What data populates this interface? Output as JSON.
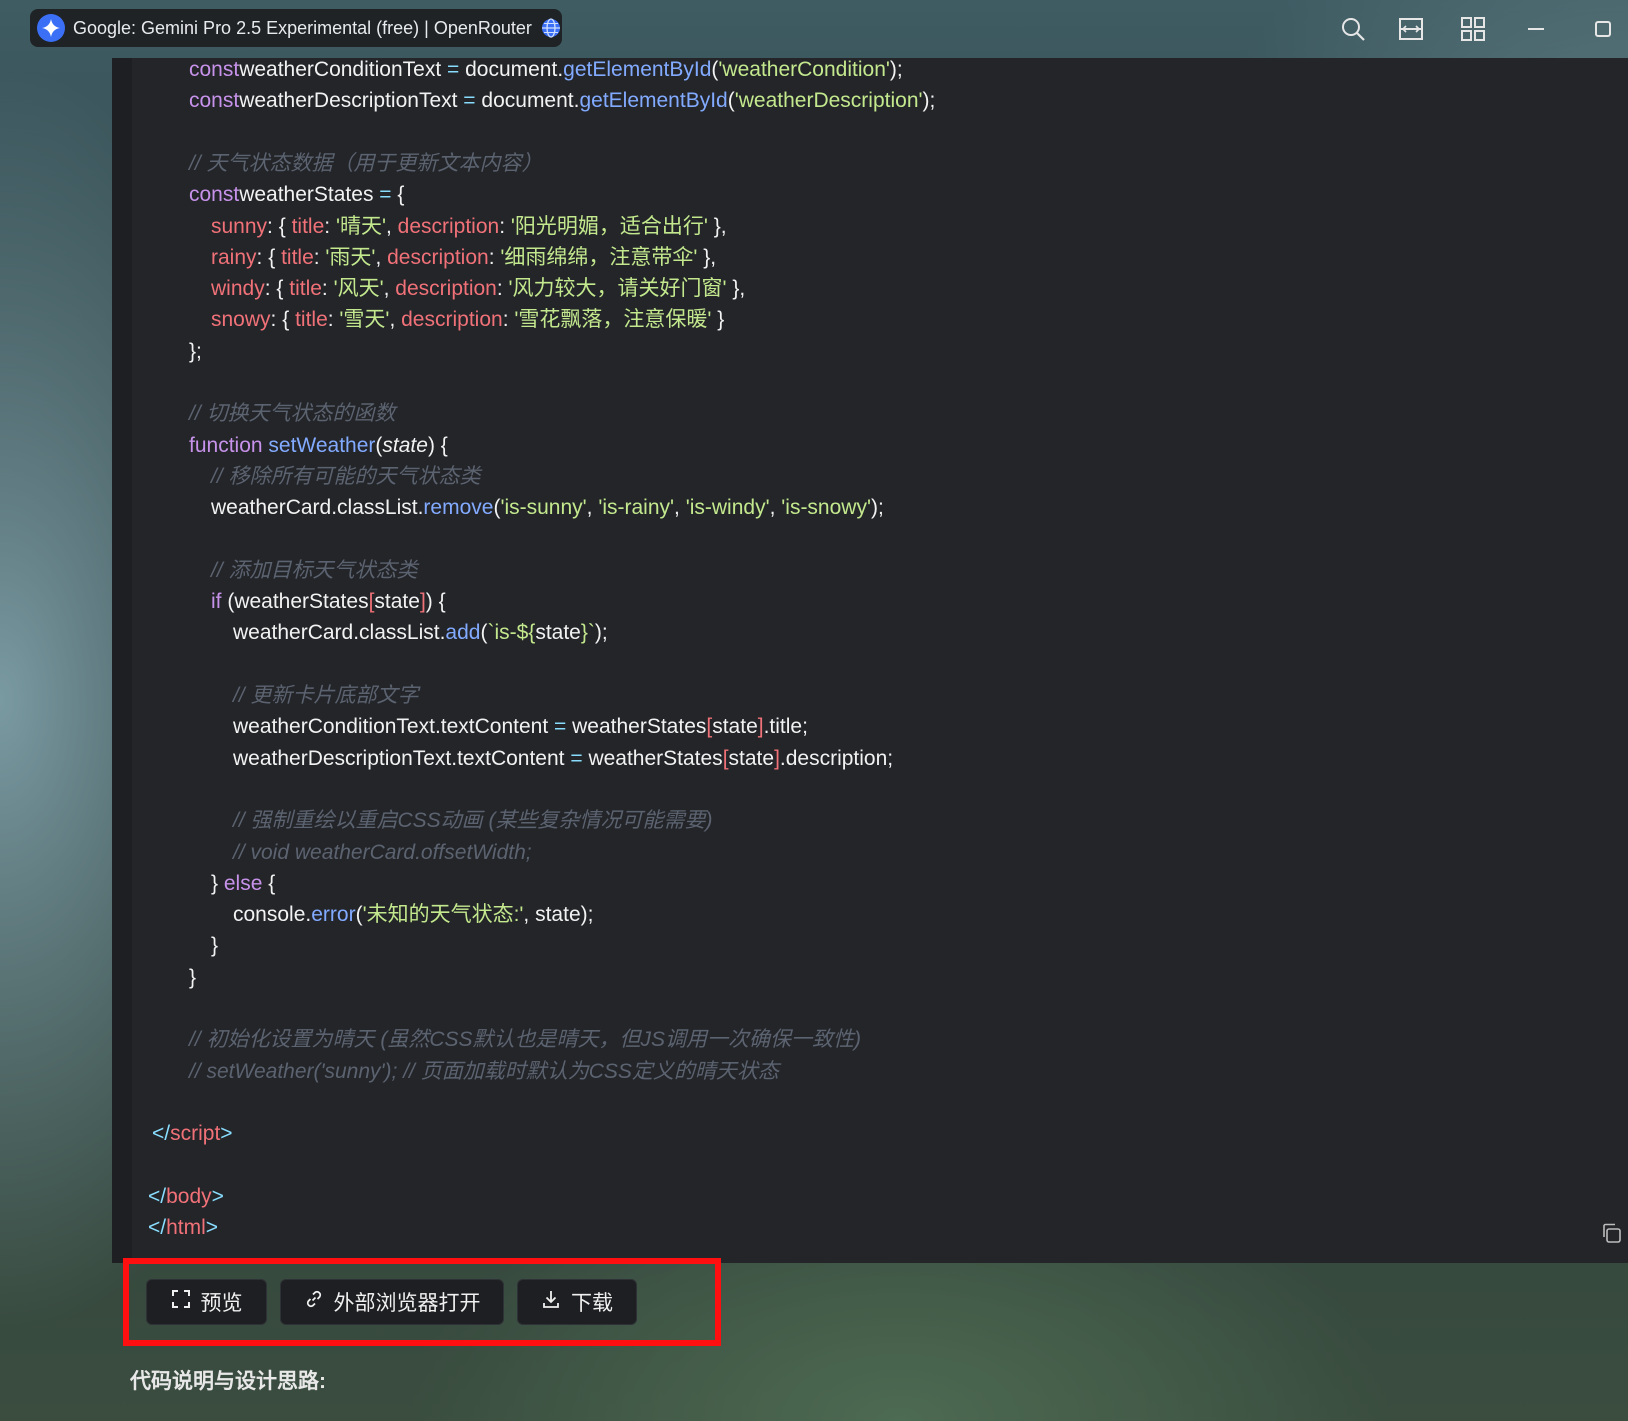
{
  "window": {
    "tab_title": "Google: Gemini Pro 2.5 Experimental (free) | OpenRouter",
    "icons": [
      "gemini-logo-icon",
      "globe-icon",
      "search-icon",
      "translate-icon",
      "grid-icon",
      "minimize-icon",
      "maximize-icon"
    ]
  },
  "code_lines": [
    {
      "indent": 2,
      "parts": [
        [
          "kw",
          "const"
        ],
        [
          "",
          "weatherConditionText"
        ],
        [
          "op",
          " = "
        ],
        [
          "",
          "document."
        ],
        [
          "fn",
          "getElementById"
        ],
        [
          "",
          "("
        ],
        [
          "str",
          "'weatherCondition'"
        ],
        [
          "",
          ");"
        ]
      ]
    },
    {
      "indent": 2,
      "parts": [
        [
          "kw",
          "const"
        ],
        [
          "",
          "weatherDescriptionText"
        ],
        [
          "op",
          " = "
        ],
        [
          "",
          "document."
        ],
        [
          "fn",
          "getElementById"
        ],
        [
          "",
          "("
        ],
        [
          "str",
          "'weatherDescription'"
        ],
        [
          "",
          ");"
        ]
      ]
    },
    {
      "indent": 0,
      "parts": []
    },
    {
      "indent": 2,
      "parts": [
        [
          "com",
          "// 天气状态数据（用于更新文本内容）"
        ]
      ]
    },
    {
      "indent": 2,
      "parts": [
        [
          "kw",
          "const"
        ],
        [
          "",
          "weatherStates"
        ],
        [
          "op",
          " = "
        ],
        [
          "",
          "{"
        ]
      ]
    },
    {
      "indent": 3,
      "parts": [
        [
          "prop",
          "sunny"
        ],
        [
          "",
          ": { "
        ],
        [
          "prop",
          "title"
        ],
        [
          "",
          ": "
        ],
        [
          "str",
          "'晴天'"
        ],
        [
          "",
          ", "
        ],
        [
          "prop",
          "description"
        ],
        [
          "",
          ": "
        ],
        [
          "str",
          "'阳光明媚，适合出行'"
        ],
        [
          "",
          " },"
        ]
      ]
    },
    {
      "indent": 3,
      "parts": [
        [
          "prop",
          "rainy"
        ],
        [
          "",
          ": { "
        ],
        [
          "prop",
          "title"
        ],
        [
          "",
          ": "
        ],
        [
          "str",
          "'雨天'"
        ],
        [
          "",
          ", "
        ],
        [
          "prop",
          "description"
        ],
        [
          "",
          ": "
        ],
        [
          "str",
          "'细雨绵绵，注意带伞'"
        ],
        [
          "",
          " },"
        ]
      ]
    },
    {
      "indent": 3,
      "parts": [
        [
          "prop",
          "windy"
        ],
        [
          "",
          ": { "
        ],
        [
          "prop",
          "title"
        ],
        [
          "",
          ": "
        ],
        [
          "str",
          "'风天'"
        ],
        [
          "",
          ", "
        ],
        [
          "prop",
          "description"
        ],
        [
          "",
          ": "
        ],
        [
          "str",
          "'风力较大，请关好门窗'"
        ],
        [
          "",
          " },"
        ]
      ]
    },
    {
      "indent": 3,
      "parts": [
        [
          "prop",
          "snowy"
        ],
        [
          "",
          ": { "
        ],
        [
          "prop",
          "title"
        ],
        [
          "",
          ": "
        ],
        [
          "str",
          "'雪天'"
        ],
        [
          "",
          ", "
        ],
        [
          "prop",
          "description"
        ],
        [
          "",
          ": "
        ],
        [
          "str",
          "'雪花飘落，注意保暖'"
        ],
        [
          "",
          " }"
        ]
      ]
    },
    {
      "indent": 2,
      "parts": [
        [
          "",
          "};"
        ]
      ]
    },
    {
      "indent": 0,
      "parts": []
    },
    {
      "indent": 2,
      "parts": [
        [
          "com",
          "// 切换天气状态的函数"
        ]
      ]
    },
    {
      "indent": 2,
      "parts": [
        [
          "kw",
          "function"
        ],
        [
          "fn",
          " setWeather"
        ],
        [
          "",
          "("
        ],
        [
          "it",
          "state"
        ],
        [
          "",
          ") {"
        ]
      ]
    },
    {
      "indent": 3,
      "parts": [
        [
          "com",
          "// 移除所有可能的天气状态类"
        ]
      ]
    },
    {
      "indent": 3,
      "parts": [
        [
          "",
          "weatherCard.classList."
        ],
        [
          "fn",
          "remove"
        ],
        [
          "",
          "("
        ],
        [
          "str",
          "'is-sunny'"
        ],
        [
          "",
          ", "
        ],
        [
          "str",
          "'is-rainy'"
        ],
        [
          "",
          ", "
        ],
        [
          "str",
          "'is-windy'"
        ],
        [
          "",
          ", "
        ],
        [
          "str",
          "'is-snowy'"
        ],
        [
          "",
          ");"
        ]
      ]
    },
    {
      "indent": 0,
      "parts": []
    },
    {
      "indent": 3,
      "parts": [
        [
          "com",
          "// 添加目标天气状态类"
        ]
      ]
    },
    {
      "indent": 3,
      "parts": [
        [
          "kw",
          "if"
        ],
        [
          "",
          " ("
        ],
        [
          "",
          "weatherStates"
        ],
        [
          "prop",
          "["
        ],
        [
          "",
          "state"
        ],
        [
          "prop",
          "]"
        ],
        [
          "",
          ") {"
        ]
      ]
    },
    {
      "indent": 4,
      "parts": [
        [
          "",
          "weatherCard.classList."
        ],
        [
          "fn",
          "add"
        ],
        [
          "",
          "("
        ],
        [
          "str",
          "`is-${"
        ],
        [
          "",
          "state"
        ],
        [
          "str",
          "}`"
        ],
        [
          "",
          ");"
        ]
      ]
    },
    {
      "indent": 0,
      "parts": []
    },
    {
      "indent": 4,
      "parts": [
        [
          "com",
          "// 更新卡片底部文字"
        ]
      ]
    },
    {
      "indent": 4,
      "parts": [
        [
          "",
          "weatherConditionText.textContent"
        ],
        [
          "op",
          " = "
        ],
        [
          "",
          "weatherStates"
        ],
        [
          "prop",
          "["
        ],
        [
          "",
          "state"
        ],
        [
          "prop",
          "]"
        ],
        [
          "",
          ".title;"
        ]
      ]
    },
    {
      "indent": 4,
      "parts": [
        [
          "",
          "weatherDescriptionText.textContent"
        ],
        [
          "op",
          " = "
        ],
        [
          "",
          "weatherStates"
        ],
        [
          "prop",
          "["
        ],
        [
          "",
          "state"
        ],
        [
          "prop",
          "]"
        ],
        [
          "",
          ".description;"
        ]
      ]
    },
    {
      "indent": 0,
      "parts": []
    },
    {
      "indent": 4,
      "parts": [
        [
          "com",
          "// 强制重绘以重启CSS动画 (某些复杂情况可能需要)"
        ]
      ]
    },
    {
      "indent": 4,
      "parts": [
        [
          "com",
          "// void weatherCard.offsetWidth;"
        ]
      ]
    },
    {
      "indent": 3,
      "parts": [
        [
          "",
          "} "
        ],
        [
          "kw",
          "else"
        ],
        [
          "",
          " {"
        ]
      ]
    },
    {
      "indent": 4,
      "parts": [
        [
          "",
          "console."
        ],
        [
          "fn",
          "error"
        ],
        [
          "",
          "("
        ],
        [
          "str",
          "'未知的天气状态:'"
        ],
        [
          "",
          ", state);"
        ]
      ]
    },
    {
      "indent": 3,
      "parts": [
        [
          "",
          "}"
        ]
      ]
    },
    {
      "indent": 2,
      "parts": [
        [
          "",
          "}"
        ]
      ]
    },
    {
      "indent": 0,
      "parts": []
    },
    {
      "indent": 2,
      "parts": [
        [
          "com",
          "// 初始化设置为晴天 (虽然CSS默认也是晴天，但JS调用一次确保一致性)"
        ]
      ]
    },
    {
      "indent": 2,
      "parts": [
        [
          "com",
          "// setWeather('sunny'); // 页面加载时默认为CSS定义的晴天状态"
        ]
      ]
    },
    {
      "indent": 0,
      "parts": []
    },
    {
      "indent": 1,
      "parts": [
        [
          "op",
          "</"
        ],
        [
          "tag",
          "script"
        ],
        [
          "op",
          ">"
        ]
      ]
    },
    {
      "indent": 0,
      "parts": []
    },
    {
      "indent": 0,
      "parts": [
        [
          "op",
          "</"
        ],
        [
          "tag",
          "body"
        ],
        [
          "op",
          ">"
        ]
      ]
    },
    {
      "indent": 0,
      "parts": [
        [
          "op",
          "</"
        ],
        [
          "tag",
          "html"
        ],
        [
          "op",
          ">"
        ]
      ]
    }
  ],
  "actions": {
    "preview_label": "预览",
    "open_external_label": "外部浏览器打开",
    "download_label": "下载"
  },
  "section_heading": "代码说明与设计思路:",
  "colors": {
    "highlight": "#ff0f0f",
    "panel": "#232529"
  }
}
